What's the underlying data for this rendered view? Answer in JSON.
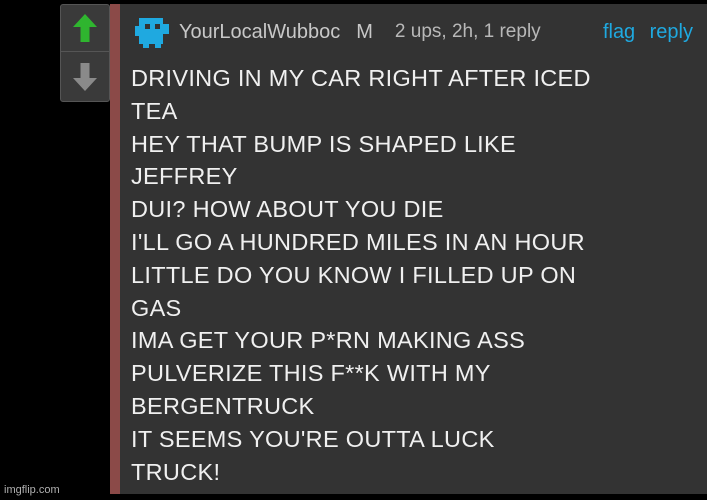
{
  "vote": {
    "up_icon": "up-arrow-icon",
    "down_icon": "down-arrow-icon",
    "up_color": "#2fb52f",
    "down_color": "#8a8a8a"
  },
  "comment": {
    "avatar_icon": "pixel-avatar-icon",
    "avatar_color": "#1fa9e0",
    "username": "YourLocalWubboc",
    "gender_badge": "M",
    "meta": "2 ups, 2h, 1 reply",
    "flag_label": "flag",
    "reply_label": "reply",
    "border_color": "#8b4a48",
    "lines": [
      "DRIVING IN MY CAR RIGHT AFTER ICED",
      "TEA",
      "HEY THAT BUMP IS SHAPED LIKE",
      "JEFFREY",
      "DUI? HOW ABOUT YOU DIE",
      "I'LL GO A HUNDRED MILES IN AN HOUR",
      "LITTLE DO YOU KNOW I FILLED UP ON",
      "GAS",
      "IMA GET YOUR P*RN MAKING ASS",
      "PULVERIZE THIS F**K WITH MY",
      "BERGENTRUCK",
      "IT SEEMS YOU'RE OUTTA LUCK",
      "TRUCK!"
    ]
  },
  "watermark": "imgflip.com"
}
